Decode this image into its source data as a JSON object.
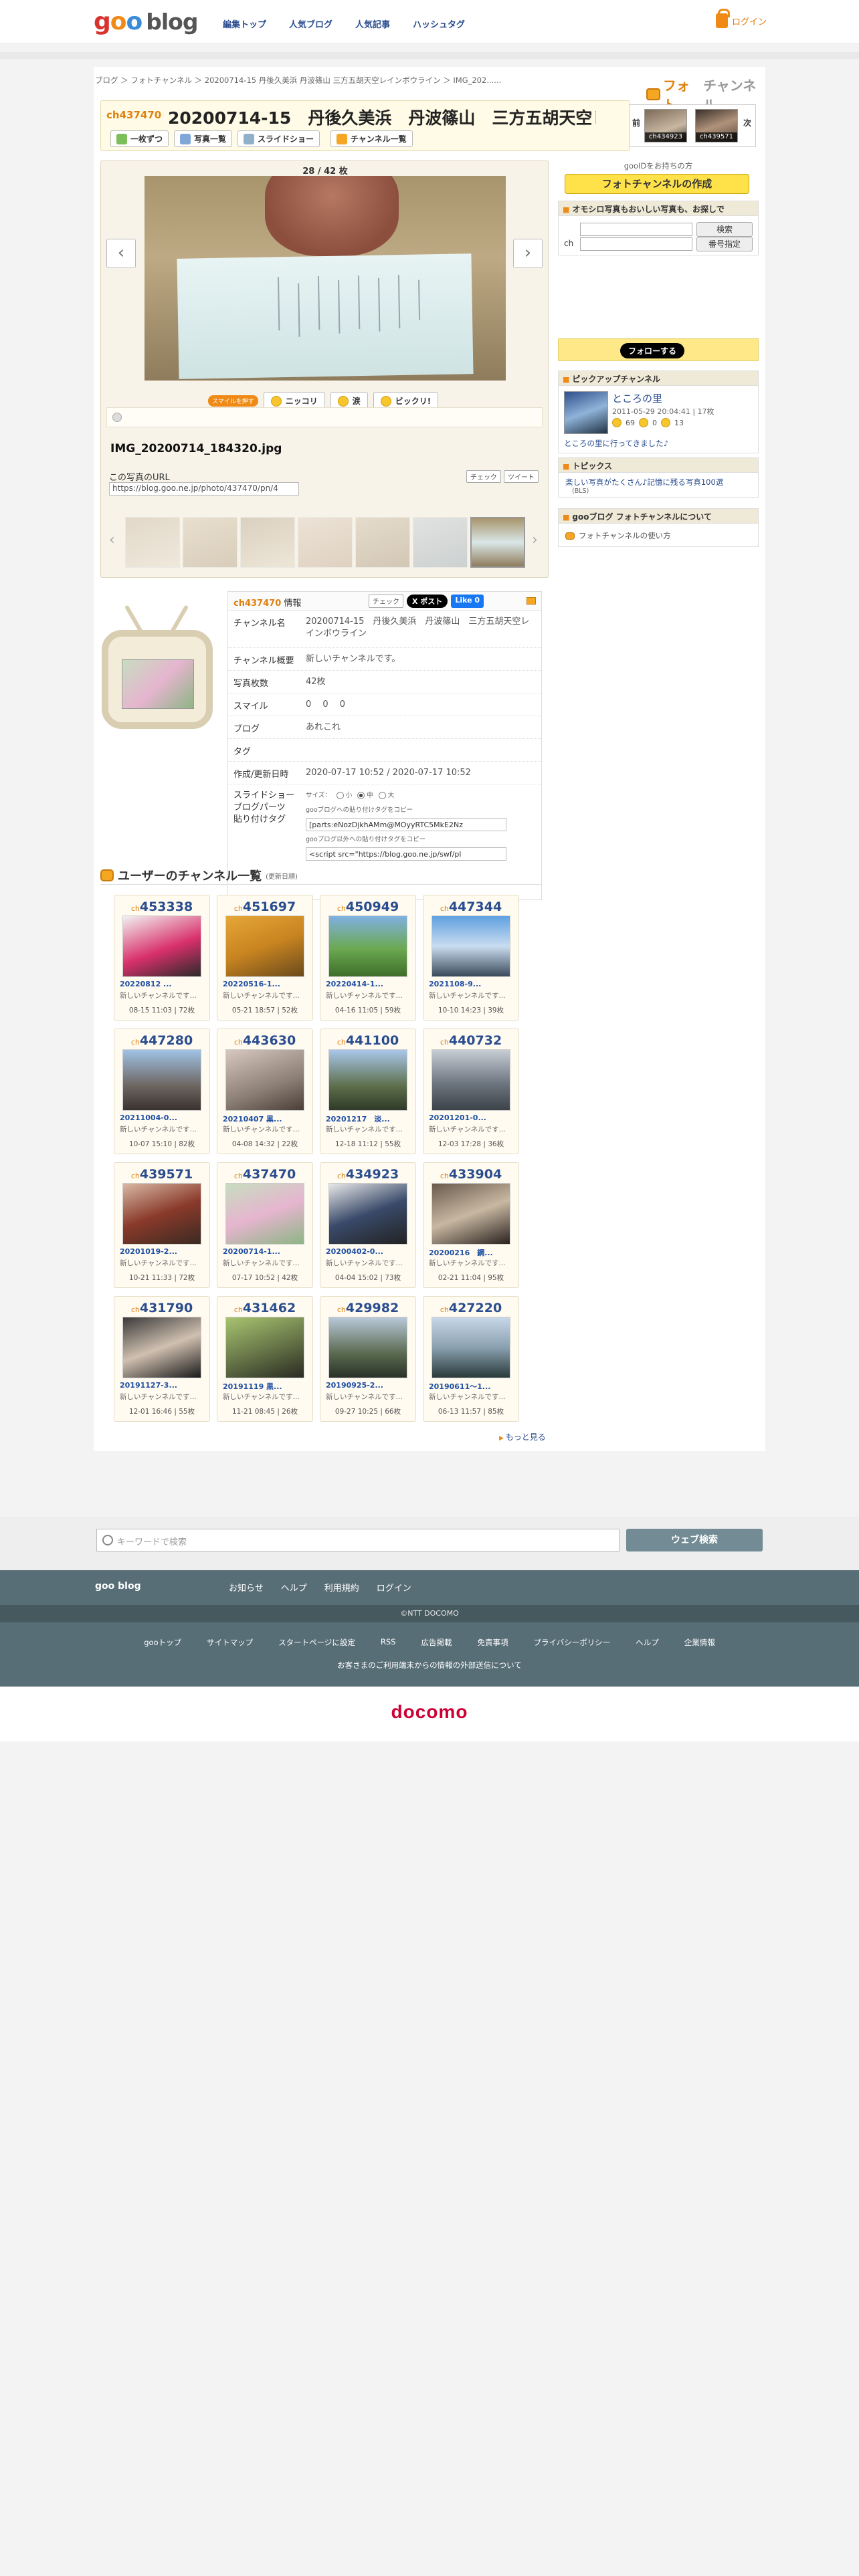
{
  "header": {
    "logo_goo": [
      "g",
      "o",
      "o"
    ],
    "logo_blog": "blog",
    "nav": [
      "編集トップ",
      "人気ブログ",
      "人気記事",
      "ハッシュタグ"
    ],
    "login": "ログイン"
  },
  "breadcrumb": [
    "ブログ",
    "フォトチャンネル",
    "20200714-15",
    "丹後久美浜",
    "丹波篠山",
    "三方五胡天空レインボウライン",
    "IMG_202......"
  ],
  "brand": {
    "photo": "フォト",
    "channel": "チャンネル"
  },
  "channel": {
    "id_label": "ch437470",
    "title": "20200714-15　丹後久美浜　丹波篠山　三方五胡天空レ...",
    "tabs": [
      "一枚ずつ",
      "写真一覧",
      "スライドショー",
      "チャンネル一覧"
    ],
    "prev_label": "前",
    "next_label": "次",
    "prev_id": "ch434923",
    "next_id": "ch439571"
  },
  "viewer": {
    "counter": "28 / 42 枚",
    "react_badge": "スマイルを押す",
    "reactions": [
      "ニッコリ",
      "涙",
      "ビックリ!"
    ],
    "filename": "IMG_20200714_184320.jpg",
    "url_label": "この写真のURL",
    "url_value": "https://blog.goo.ne.jp/photo/437470/pn/4",
    "share_check": "チェック",
    "share_tweet": "ツイート"
  },
  "info": {
    "head_id": "ch437470",
    "head_suffix": " 情報",
    "btn_check": "チェック",
    "btn_post": "X ポスト",
    "btn_like": "Like 0",
    "rows": {
      "name_k": "チャンネル名",
      "name_v": "20200714-15　丹後久美浜　丹波篠山　三方五胡天空レインボウライン",
      "desc_k": "チャンネル概要",
      "desc_v": "新しいチャンネルです。",
      "count_k": "写真枚数",
      "count_v": "42枚",
      "smile_k": "スマイル",
      "smile_v": "0　 0　 0",
      "blog_k": "ブログ",
      "blog_v": "あれこれ",
      "tag_k": "タグ",
      "tag_v": "",
      "date_k": "作成/更新日時",
      "date_v": "2020-07-17 10:52 / 2020-07-17 10:52",
      "slide_k": "スライドショー\nブログパーツ\n貼り付けタグ",
      "size_label": "サイズ：",
      "size_small": "小",
      "size_mid": "中",
      "size_large": "大",
      "goo_note": "gooブログへの貼り付けタグをコピー",
      "goo_tag": "[parts:eNozDjkhAMm@MOyyRTC5MkE2Nz",
      "other_note": "gooブログ以外への貼り付けタグをコピー",
      "other_tag": "<script src=\"https://blog.goo.ne.jp/swf/pl"
    }
  },
  "ulist": {
    "title": "ユーザーのチャンネル一覧",
    "sub": "(更新日順)",
    "more": "もっと見る",
    "cards": [
      {
        "id": "453338",
        "t": "20220812 ...",
        "d": "新しいチャンネルです...",
        "m": "08-15 11:03 | 72枚"
      },
      {
        "id": "451697",
        "t": "20220516-1...",
        "d": "新しいチャンネルです...",
        "m": "05-21 18:57 | 52枚"
      },
      {
        "id": "450949",
        "t": "20220414-1...",
        "d": "新しいチャンネルです...",
        "m": "04-16 11:05 | 59枚"
      },
      {
        "id": "447344",
        "t": "2021108-9...",
        "d": "新しいチャンネルです...",
        "m": "10-10 14:23 | 39枚"
      },
      {
        "id": "447280",
        "t": "20211004-0...",
        "d": "新しいチャンネルです...",
        "m": "10-07 15:10 | 82枚"
      },
      {
        "id": "443630",
        "t": "20210407 黒...",
        "d": "新しいチャンネルです...",
        "m": "04-08 14:32 | 22枚"
      },
      {
        "id": "441100",
        "t": "20201217　淡...",
        "d": "新しいチャンネルです...",
        "m": "12-18 11:12 | 55枚"
      },
      {
        "id": "440732",
        "t": "20201201-0...",
        "d": "新しいチャンネルです...",
        "m": "12-03 17:28 | 36枚"
      },
      {
        "id": "439571",
        "t": "20201019-2...",
        "d": "新しいチャンネルです...",
        "m": "10-21 11:33 | 72枚"
      },
      {
        "id": "437470",
        "t": "20200714-1...",
        "d": "新しいチャンネルです...",
        "m": "07-17 10:52 | 42枚"
      },
      {
        "id": "434923",
        "t": "20200402-0...",
        "d": "新しいチャンネルです...",
        "m": "04-04 15:02 | 73枚"
      },
      {
        "id": "433904",
        "t": "20200216　鋼...",
        "d": "新しいチャンネルです...",
        "m": "02-21 11:04 | 95枚"
      },
      {
        "id": "431790",
        "t": "20191127-3...",
        "d": "新しいチャンネルです...",
        "m": "12-01 16:46 | 55枚"
      },
      {
        "id": "431462",
        "t": "20191119 黒...",
        "d": "新しいチャンネルです...",
        "m": "11-21 08:45 | 26枚"
      },
      {
        "id": "429982",
        "t": "20190925-2...",
        "d": "新しいチャンネルです...",
        "m": "09-27 10:25 | 66枚"
      },
      {
        "id": "427220",
        "t": "20190611〜1...",
        "d": "新しいチャンネルです...",
        "m": "06-13 11:57 | 85枚"
      }
    ]
  },
  "sidebar": {
    "note": "gooIDをお持ちの方",
    "create": "フォトチャンネルの作成",
    "search_head": "オモシロ写真もおいしい写真も、お探しで",
    "search_btn": "検索",
    "ch_label": "ch",
    "num_btn": "番号指定",
    "follow": "フォローする",
    "pickup_head": "ピックアップチャンネル",
    "pickup_name": "ところの里",
    "pickup_meta": "2011-05-29 20:04:41 | 17枚",
    "pickup_r": [
      "69",
      "0",
      "13"
    ],
    "pickup_link": "ところの里に行ってきました♪",
    "topics_head": "トピックス",
    "topic1": "楽しい写真がたくさん♪記憶に残る写真100選",
    "topic1_sub": "(BLS)",
    "about_head": "gooブログ フォトチャンネルについて",
    "about_link": "フォトチャンネルの使い方"
  },
  "footer": {
    "placeholder": "キーワードで検索",
    "search_btn": "ウェブ検索",
    "brand": "goo blog",
    "links1": [
      "お知らせ",
      "ヘルプ",
      "利用規約",
      "ログイン"
    ],
    "copyright": "©NTT DOCOMO",
    "links2": [
      "gooトップ",
      "サイトマップ",
      "スタートページに設定",
      "RSS",
      "広告掲載",
      "免責事項",
      "プライバシーポリシー",
      "ヘルプ",
      "企業情報"
    ],
    "note": "お客さまのご利用端末からの情報の外部送信について",
    "docomo": "docomo"
  }
}
